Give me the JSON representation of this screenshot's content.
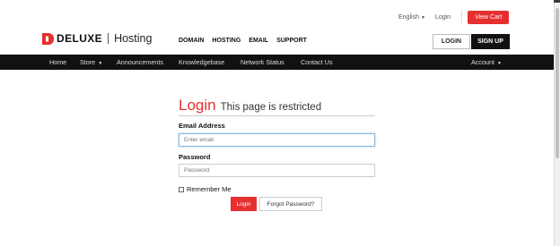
{
  "toplinks": {
    "language": "English",
    "login": "Login",
    "view_cart": "View Cart"
  },
  "brand": {
    "name": "DELUXE",
    "product": "Hosting",
    "accent": "#e62f2f"
  },
  "mainnav": [
    "DOMAIN",
    "HOSTING",
    "EMAIL",
    "SUPPORT"
  ],
  "header_buttons": {
    "login": "LOGIN",
    "signup": "SIGN UP"
  },
  "navbar": {
    "home": "Home",
    "store": "Store",
    "announcements": "Announcements",
    "knowledgebase": "Knowledgebase",
    "network_status": "Network Status",
    "contact_us": "Contact Us",
    "account": "Account"
  },
  "login_form": {
    "title": "Login",
    "subtitle": "This page is restricted",
    "email_label": "Email Address",
    "email_placeholder": "Enter email",
    "password_label": "Password",
    "password_placeholder": "Password",
    "remember_label": "Remember Me",
    "login_button": "Login",
    "forgot_button": "Forgot Password?"
  }
}
